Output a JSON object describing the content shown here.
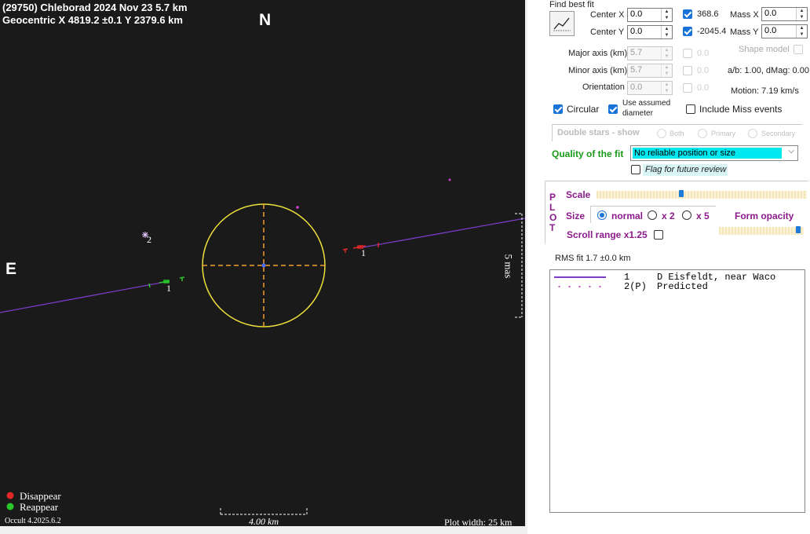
{
  "plot": {
    "title": "(29750) Chleborad  2024 Nov 23   5.7 km",
    "subtitle": "Geocentric  X  4819.2 ±0.1  Y 2379.6 km",
    "north": "N",
    "east": "E",
    "chord_label_1a": "1",
    "chord_label_1b": "1",
    "star_label": "2",
    "scale_right": "5 mas",
    "scale_bottom": "4.00 km",
    "legend_disappear": "Disappear",
    "legend_reappear": "Reappear",
    "version": "Occult 4.2025.6.2",
    "plot_width": "Plot width: 25 km",
    "colors": {
      "background": "#1a1a1a",
      "ellipse": "#f0e03c",
      "cross": "#f0a030",
      "chord": "#7b3cc8",
      "disappear": "#e02828",
      "reappear": "#28c828"
    }
  },
  "panel": {
    "find_best_fit": "Find best fit",
    "fit_icon": "fit-curve-icon",
    "center_x_label": "Center X",
    "center_x_value": "0.0",
    "center_y_label": "Center Y",
    "center_y_value": "0.0",
    "offset_x": "368.6",
    "offset_y": "-2045.4",
    "mass_x_label": "Mass X",
    "mass_x_value": "0.0",
    "mass_y_label": "Mass Y",
    "mass_y_value": "0.0",
    "shape_model": "Shape model",
    "major_label": "Major axis (km)",
    "major_value": "5.7",
    "minor_label": "Minor axis (km)",
    "minor_value": "5.7",
    "orient_label": "Orientation",
    "orient_value": "0.0",
    "dis_val_1": "0.0",
    "dis_val_2": "0.0",
    "dis_val_3": "0.0",
    "ab_text": "a/b: 1.00, dMag: 0.00",
    "motion": "Motion: 7.19 km/s",
    "circular": "Circular",
    "use_assumed_1": "Use assumed",
    "use_assumed_2": "diameter",
    "include_miss": "Include Miss events",
    "double_stars": "Double stars - show",
    "both": "Both",
    "primary": "Primary",
    "secondary": "Secondary",
    "quality_label": "Quality of the fit",
    "quality_value": "No reliable position or size",
    "flag_review": "Flag for future review",
    "plot_letters": [
      "P",
      "L",
      "O",
      "T"
    ],
    "scale_label": "Scale",
    "size_label": "Size",
    "size_normal": "normal",
    "size_x2": "x 2",
    "size_x5": "x 5",
    "form_opacity": "Form opacity",
    "scroll_range": "Scroll range x1.25",
    "scale_slider_fraction": 0.4,
    "opacity_slider_fraction": 1.0,
    "rms_fit": "RMS fit 1.7 ±0.0 km",
    "list": [
      {
        "num": "1",
        "text": "D Eisfeldt, near Waco"
      },
      {
        "num": "2(P)",
        "text": "Predicted"
      }
    ]
  }
}
